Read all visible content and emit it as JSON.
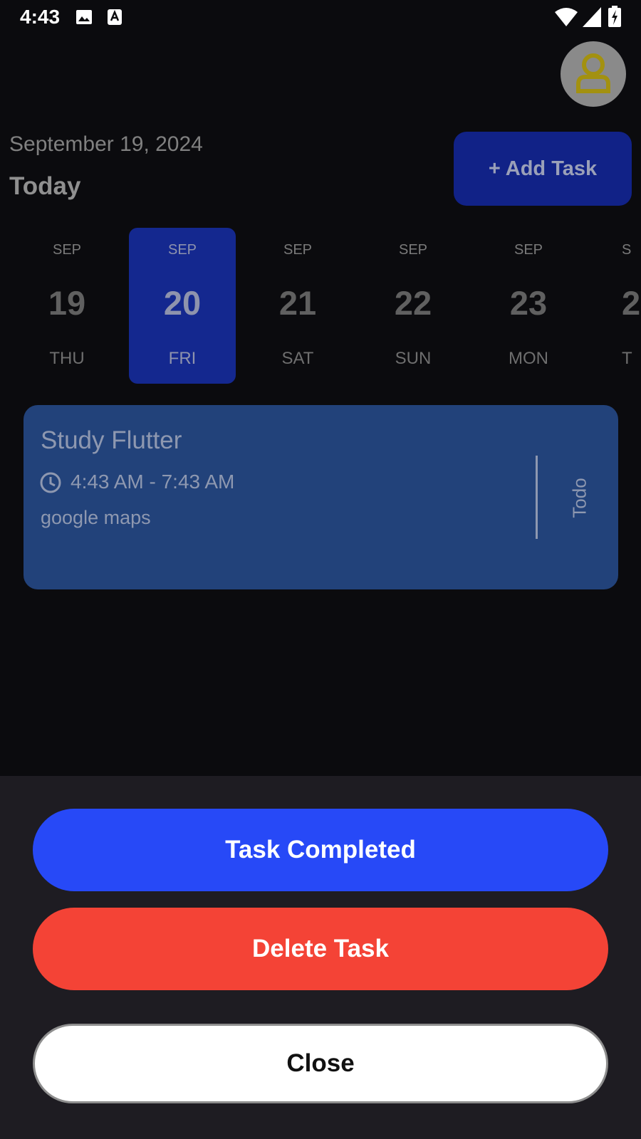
{
  "status_bar": {
    "time": "4:43"
  },
  "header": {
    "date": "September 19, 2024",
    "title": "Today",
    "add_task_label": "+ Add Task"
  },
  "date_strip": [
    {
      "month": "SEP",
      "day": "19",
      "weekday": "THU",
      "selected": false
    },
    {
      "month": "SEP",
      "day": "20",
      "weekday": "FRI",
      "selected": true
    },
    {
      "month": "SEP",
      "day": "21",
      "weekday": "SAT",
      "selected": false
    },
    {
      "month": "SEP",
      "day": "22",
      "weekday": "SUN",
      "selected": false
    },
    {
      "month": "SEP",
      "day": "23",
      "weekday": "MON",
      "selected": false
    },
    {
      "month": "S",
      "day": "2",
      "weekday": "T",
      "selected": false
    }
  ],
  "task": {
    "title": "Study Flutter",
    "time": "4:43 AM - 7:43 AM",
    "note": "google maps",
    "status": "Todo"
  },
  "sheet": {
    "complete_label": "Task Completed",
    "delete_label": "Delete Task",
    "close_label": "Close"
  },
  "colors": {
    "selected_day": "#14288f",
    "task_card": "#22427a",
    "complete_button": "#2749f7",
    "delete_button": "#f44336"
  }
}
